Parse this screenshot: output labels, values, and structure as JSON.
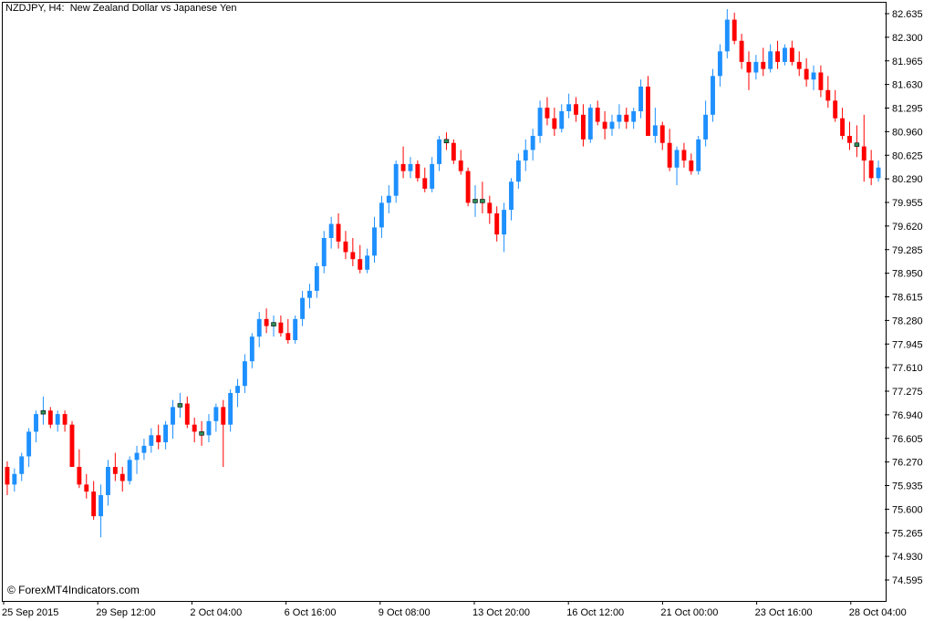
{
  "chart_title": "NZDJPY, H4:  New Zealand Dollar vs Japanese Yen",
  "watermark": "© ForexMT4Indicators.com",
  "chart_data": {
    "type": "candlestick",
    "symbol": "NZDJPY",
    "timeframe": "H4",
    "description": "New Zealand Dollar vs Japanese Yen",
    "y_ticks": [
      82.635,
      82.3,
      81.965,
      81.63,
      81.295,
      80.96,
      80.625,
      80.29,
      79.955,
      79.62,
      79.285,
      78.95,
      78.615,
      78.28,
      77.945,
      77.61,
      77.275,
      76.94,
      76.605,
      76.27,
      75.935,
      75.6,
      75.265,
      74.93,
      74.595
    ],
    "y_tick_labels": [
      "82.635",
      "82.300",
      "81.965",
      "81.630",
      "81.295",
      "80.960",
      "80.625",
      "80.290",
      "79.955",
      "79.620",
      "79.285",
      "78.950",
      "78.615",
      "78.280",
      "77.945",
      "77.610",
      "77.275",
      "76.940",
      "76.605",
      "76.270",
      "75.935",
      "75.600",
      "75.265",
      "74.930",
      "74.595"
    ],
    "x_tick_labels": [
      "25 Sep 2015",
      "29 Sep 12:00",
      "2 Oct 04:00",
      "6 Oct 16:00",
      "9 Oct 08:00",
      "13 Oct 20:00",
      "16 Oct 12:00",
      "21 Oct 00:00",
      "23 Oct 16:00",
      "28 Oct 04:00"
    ],
    "ylim": [
      74.4,
      82.8
    ],
    "colors": {
      "bull_body": "#1e90ff",
      "bear_body": "#ff0000",
      "doji_body": "#2e8b57",
      "bull_wick": "#1e90ff",
      "bear_wick": "#ff0000",
      "axis": "#000000"
    },
    "candles": [
      [
        76.2,
        76.28,
        75.8,
        75.95
      ],
      [
        75.95,
        76.18,
        75.85,
        76.1
      ],
      [
        76.1,
        76.4,
        76.0,
        76.35
      ],
      [
        76.35,
        76.75,
        76.2,
        76.7
      ],
      [
        76.7,
        77.0,
        76.55,
        76.95
      ],
      [
        76.95,
        77.2,
        76.8,
        77.0
      ],
      [
        77.0,
        77.05,
        76.75,
        76.8
      ],
      [
        76.8,
        77.0,
        76.7,
        76.95
      ],
      [
        76.95,
        77.0,
        76.7,
        76.8
      ],
      [
        76.8,
        76.85,
        76.2,
        76.2
      ],
      [
        76.2,
        76.45,
        75.9,
        75.95
      ],
      [
        75.95,
        76.1,
        75.75,
        75.85
      ],
      [
        75.85,
        76.0,
        75.45,
        75.5
      ],
      [
        75.5,
        75.95,
        75.2,
        75.8
      ],
      [
        75.8,
        76.3,
        75.65,
        76.2
      ],
      [
        76.2,
        76.4,
        76.0,
        76.1
      ],
      [
        76.1,
        76.2,
        75.85,
        76.0
      ],
      [
        76.0,
        76.35,
        75.95,
        76.3
      ],
      [
        76.3,
        76.5,
        76.1,
        76.4
      ],
      [
        76.4,
        76.6,
        76.3,
        76.5
      ],
      [
        76.5,
        76.75,
        76.4,
        76.65
      ],
      [
        76.65,
        76.8,
        76.45,
        76.55
      ],
      [
        76.55,
        76.85,
        76.45,
        76.8
      ],
      [
        76.8,
        77.15,
        76.6,
        77.05
      ],
      [
        77.05,
        77.25,
        76.9,
        77.1
      ],
      [
        77.1,
        77.2,
        76.75,
        76.8
      ],
      [
        76.8,
        76.9,
        76.55,
        76.7
      ],
      [
        76.7,
        76.85,
        76.5,
        76.65
      ],
      [
        76.65,
        76.95,
        76.55,
        76.85
      ],
      [
        76.85,
        77.1,
        76.7,
        77.05
      ],
      [
        77.05,
        77.15,
        76.2,
        76.8
      ],
      [
        76.8,
        77.3,
        76.7,
        77.25
      ],
      [
        77.25,
        77.45,
        77.05,
        77.35
      ],
      [
        77.35,
        77.8,
        77.25,
        77.7
      ],
      [
        77.7,
        78.1,
        77.6,
        78.05
      ],
      [
        78.05,
        78.4,
        77.9,
        78.3
      ],
      [
        78.3,
        78.45,
        78.1,
        78.2
      ],
      [
        78.2,
        78.35,
        78.05,
        78.25
      ],
      [
        78.25,
        78.35,
        78.05,
        78.1
      ],
      [
        78.1,
        78.3,
        77.95,
        78.0
      ],
      [
        78.0,
        78.35,
        77.95,
        78.3
      ],
      [
        78.3,
        78.7,
        78.2,
        78.6
      ],
      [
        78.6,
        78.8,
        78.45,
        78.7
      ],
      [
        78.7,
        79.1,
        78.6,
        79.05
      ],
      [
        79.05,
        79.55,
        78.95,
        79.45
      ],
      [
        79.45,
        79.75,
        79.3,
        79.65
      ],
      [
        79.65,
        79.8,
        79.3,
        79.4
      ],
      [
        79.4,
        79.55,
        79.15,
        79.25
      ],
      [
        79.25,
        79.45,
        79.05,
        79.15
      ],
      [
        79.15,
        79.35,
        78.95,
        79.0
      ],
      [
        79.0,
        79.3,
        78.95,
        79.2
      ],
      [
        79.2,
        79.75,
        79.1,
        79.6
      ],
      [
        79.6,
        80.05,
        79.45,
        79.95
      ],
      [
        79.95,
        80.2,
        79.8,
        80.05
      ],
      [
        80.05,
        80.55,
        79.95,
        80.5
      ],
      [
        80.5,
        80.75,
        80.3,
        80.4
      ],
      [
        80.4,
        80.6,
        80.3,
        80.5
      ],
      [
        80.5,
        80.55,
        80.25,
        80.3
      ],
      [
        80.3,
        80.45,
        80.1,
        80.15
      ],
      [
        80.15,
        80.6,
        80.1,
        80.5
      ],
      [
        80.5,
        80.9,
        80.4,
        80.85
      ],
      [
        80.85,
        80.95,
        80.7,
        80.8
      ],
      [
        80.8,
        80.85,
        80.5,
        80.55
      ],
      [
        80.55,
        80.7,
        80.35,
        80.4
      ],
      [
        80.4,
        80.45,
        79.9,
        79.95
      ],
      [
        79.95,
        80.2,
        79.75,
        80.0
      ],
      [
        80.0,
        80.25,
        79.8,
        79.95
      ],
      [
        79.95,
        80.05,
        79.65,
        79.8
      ],
      [
        79.8,
        79.9,
        79.4,
        79.5
      ],
      [
        79.5,
        79.95,
        79.25,
        79.85
      ],
      [
        79.85,
        80.3,
        79.7,
        80.25
      ],
      [
        80.25,
        80.65,
        80.15,
        80.55
      ],
      [
        80.55,
        80.85,
        80.4,
        80.7
      ],
      [
        80.7,
        81.0,
        80.55,
        80.9
      ],
      [
        80.9,
        81.4,
        80.8,
        81.3
      ],
      [
        81.3,
        81.45,
        81.05,
        81.15
      ],
      [
        81.15,
        81.3,
        80.9,
        81.0
      ],
      [
        81.0,
        81.35,
        80.95,
        81.25
      ],
      [
        81.25,
        81.5,
        81.15,
        81.35
      ],
      [
        81.35,
        81.45,
        81.1,
        81.2
      ],
      [
        81.2,
        81.35,
        80.75,
        80.85
      ],
      [
        80.85,
        81.35,
        80.8,
        81.3
      ],
      [
        81.3,
        81.4,
        81.05,
        81.1
      ],
      [
        81.1,
        81.25,
        80.85,
        81.0
      ],
      [
        81.0,
        81.2,
        80.9,
        81.1
      ],
      [
        81.1,
        81.35,
        81.0,
        81.2
      ],
      [
        81.2,
        81.3,
        81.0,
        81.1
      ],
      [
        81.1,
        81.3,
        81.0,
        81.25
      ],
      [
        81.25,
        81.7,
        81.15,
        81.6
      ],
      [
        81.6,
        81.75,
        80.9,
        80.9
      ],
      [
        80.9,
        81.3,
        80.8,
        81.05
      ],
      [
        81.05,
        81.1,
        80.7,
        80.8
      ],
      [
        80.8,
        81.0,
        80.4,
        80.45
      ],
      [
        80.45,
        80.75,
        80.2,
        80.7
      ],
      [
        80.7,
        80.8,
        80.45,
        80.55
      ],
      [
        80.55,
        80.65,
        80.35,
        80.4
      ],
      [
        80.4,
        80.9,
        80.35,
        80.85
      ],
      [
        80.85,
        81.4,
        80.75,
        81.2
      ],
      [
        81.2,
        81.85,
        81.1,
        81.75
      ],
      [
        81.75,
        82.2,
        81.6,
        82.1
      ],
      [
        82.1,
        82.7,
        82.0,
        82.55
      ],
      [
        82.55,
        82.65,
        82.2,
        82.25
      ],
      [
        82.25,
        82.35,
        81.85,
        81.95
      ],
      [
        81.95,
        82.1,
        81.55,
        81.8
      ],
      [
        81.8,
        82.05,
        81.7,
        81.95
      ],
      [
        81.95,
        82.15,
        81.75,
        81.85
      ],
      [
        81.85,
        82.2,
        81.8,
        82.1
      ],
      [
        82.1,
        82.25,
        81.85,
        81.95
      ],
      [
        81.95,
        82.2,
        81.9,
        82.15
      ],
      [
        82.15,
        82.25,
        81.9,
        81.95
      ],
      [
        81.95,
        82.1,
        81.75,
        81.85
      ],
      [
        81.85,
        82.0,
        81.6,
        81.7
      ],
      [
        81.7,
        81.9,
        81.55,
        81.8
      ],
      [
        81.8,
        81.9,
        81.45,
        81.55
      ],
      [
        81.55,
        81.75,
        81.3,
        81.4
      ],
      [
        81.4,
        81.55,
        81.1,
        81.15
      ],
      [
        81.15,
        81.3,
        80.85,
        80.9
      ],
      [
        80.9,
        81.1,
        80.7,
        80.8
      ],
      [
        80.8,
        81.05,
        80.6,
        80.75
      ],
      [
        80.75,
        81.2,
        80.25,
        80.55
      ],
      [
        80.55,
        80.7,
        80.2,
        80.3
      ],
      [
        80.3,
        80.55,
        80.25,
        80.45
      ]
    ]
  }
}
